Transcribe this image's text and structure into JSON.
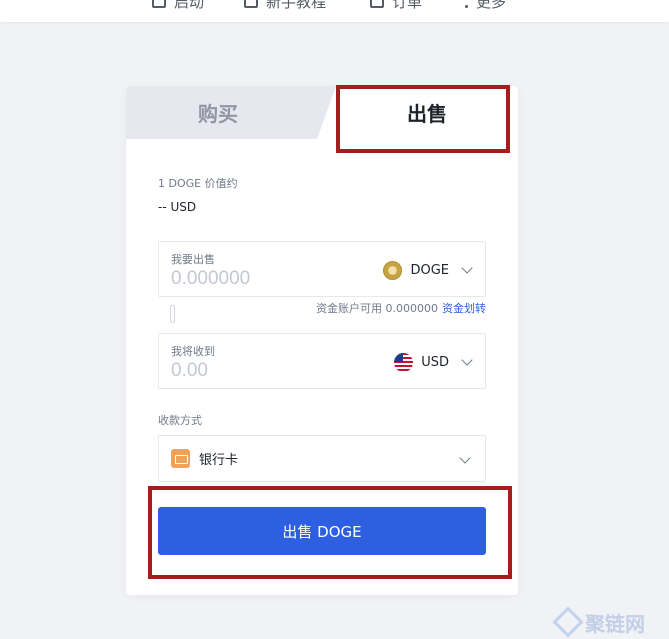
{
  "top_nav": {
    "items": [
      {
        "label": "启动",
        "icon": "rocket-icon"
      },
      {
        "label": "新手教程",
        "icon": "book-icon"
      },
      {
        "label": "订单",
        "icon": "order-icon"
      },
      {
        "label": "更多",
        "icon": "more-icon"
      }
    ]
  },
  "tabs": {
    "buy": "购买",
    "sell": "出售",
    "active": "sell"
  },
  "price": {
    "label": "1 DOGE 价值约",
    "value": "-- USD"
  },
  "sell_field": {
    "label": "我要出售",
    "placeholder": "0.000000",
    "asset": "DOGE",
    "asset_icon": "doge-coin-icon"
  },
  "available": {
    "text": "资金账户可用 0.000000",
    "link": "资金划转"
  },
  "receive_field": {
    "label": "我将收到",
    "placeholder": "0.00",
    "asset": "USD",
    "asset_icon": "us-flag-icon"
  },
  "payment": {
    "label": "收款方式",
    "selected": "银行卡",
    "icon": "bank-card-icon"
  },
  "submit": {
    "label": "出售 DOGE"
  },
  "watermark": {
    "text": "聚链网"
  },
  "colors": {
    "primary": "#2d5fe0",
    "highlight": "#a51e1e",
    "link": "#2b5fd9",
    "background": "#f1f2f5"
  }
}
